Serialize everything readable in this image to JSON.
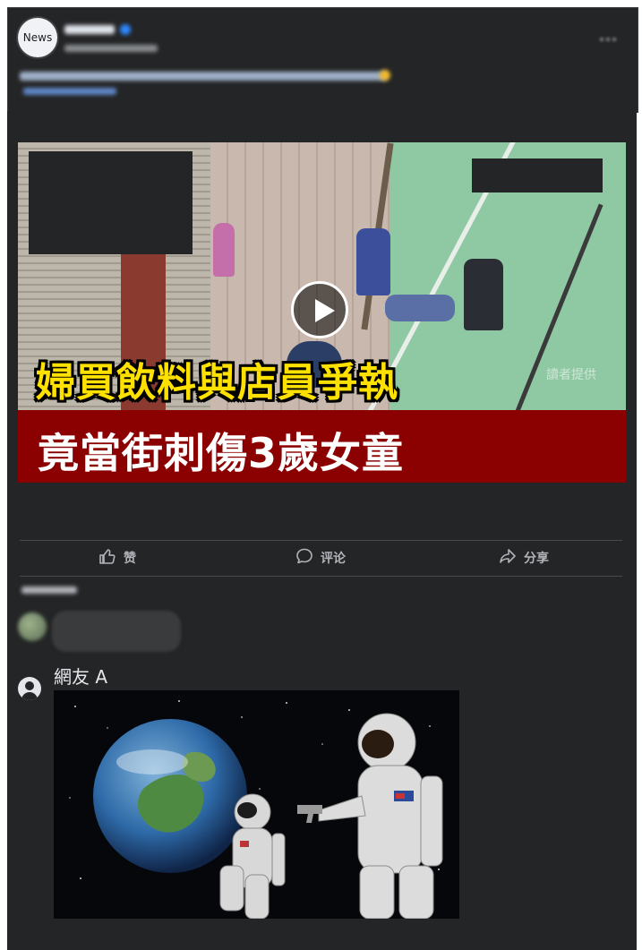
{
  "post": {
    "page_avatar_text": "News",
    "author_name_blurred": "",
    "timestamp_blurred": "",
    "more_icon": "more-horizontal-icon"
  },
  "video": {
    "headline_line1": "婦買飲料與店員爭執",
    "headline_line2": "竟當街刺傷3歲女童",
    "credit_text": "讀者提供",
    "headline_color": "#ffe100",
    "band_color": "#8b0000",
    "play_icon": "play-icon"
  },
  "actions": [
    {
      "label": "赞",
      "icon": "thumbs-up-icon"
    },
    {
      "label": "评论",
      "icon": "comment-icon"
    },
    {
      "label": "分享",
      "icon": "share-icon"
    }
  ],
  "comments": {
    "commenter_name": "網友 A",
    "commenter_icon": "user-avatar-icon",
    "meme_image": "astronaut-meme-image"
  },
  "theme": {
    "background": "#242526",
    "text_muted": "#b0b3b8",
    "text_primary": "#e4e6eb"
  }
}
